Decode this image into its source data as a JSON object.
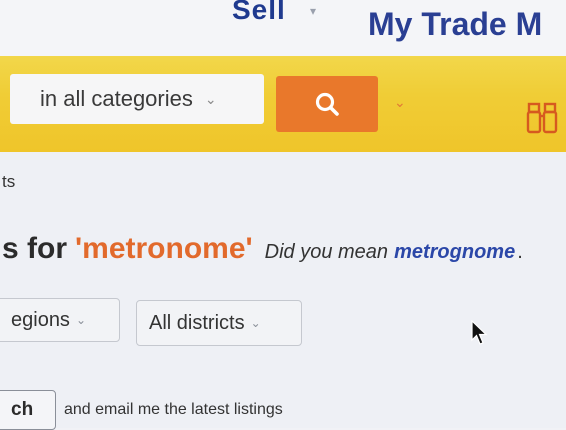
{
  "header": {
    "sell_label": "Sell",
    "my_trade_me_label": "My Trade M"
  },
  "search": {
    "category_label": "in all categories",
    "button_icon": "search-icon",
    "menu_icon": "chevron-down-icon",
    "watchlist_icon": "binoculars-icon"
  },
  "tabs": {
    "fragment": "ts"
  },
  "results": {
    "prefix": "s for",
    "query": "'metronome'",
    "did_you_mean": "Did you mean",
    "suggestion": "metrognome",
    "suggestion_end": "."
  },
  "filters": {
    "region_value": "egions",
    "district_value": "All districts"
  },
  "save_search": {
    "button_label": "ch",
    "description": "and email me the latest listings"
  },
  "colors": {
    "accent_orange": "#e9782b",
    "header_yellow": "#f0cd36",
    "link_blue": "#2b47a8",
    "query_orange": "#e26a2c"
  }
}
